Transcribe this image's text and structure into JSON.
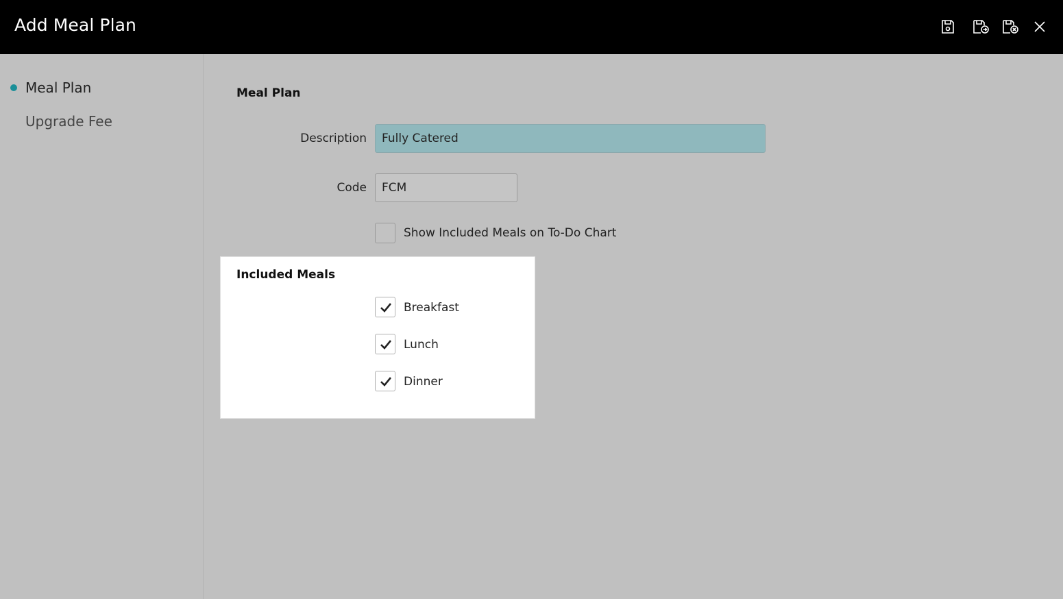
{
  "window": {
    "title": "Add Meal Plan",
    "toolbar_icons": [
      "save-icon",
      "save-and-new-icon",
      "save-and-close-icon",
      "close-icon"
    ]
  },
  "sidebar": {
    "items": [
      {
        "label": "Meal Plan",
        "active": true
      },
      {
        "label": "Upgrade Fee",
        "active": false
      }
    ],
    "accent_color": "#1a8f98"
  },
  "form": {
    "section_title": "Meal Plan",
    "description": {
      "label": "Description",
      "value": "Fully Catered"
    },
    "code": {
      "label": "Code",
      "value": "FCM"
    },
    "show_on_todo": {
      "label": "Show Included Meals on To-Do Chart",
      "checked": false
    }
  },
  "included_meals": {
    "title": "Included Meals",
    "items": [
      {
        "label": "Breakfast",
        "checked": true
      },
      {
        "label": "Lunch",
        "checked": true
      },
      {
        "label": "Dinner",
        "checked": true
      }
    ]
  }
}
